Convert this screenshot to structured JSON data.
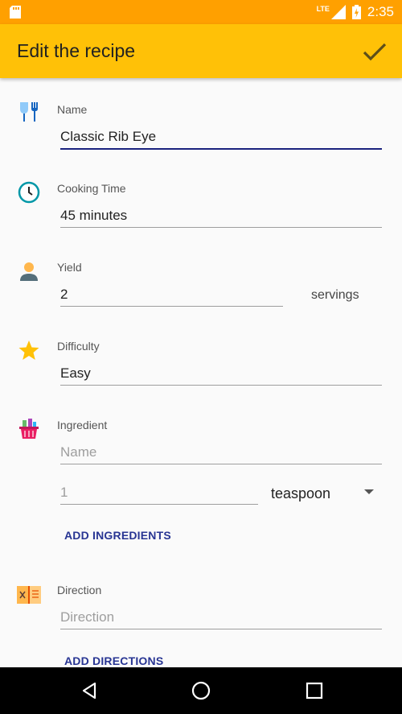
{
  "status_bar": {
    "network": "LTE",
    "time": "2:35"
  },
  "app_bar": {
    "title": "Edit the recipe",
    "confirm_icon": "check-icon"
  },
  "form": {
    "name": {
      "label": "Name",
      "value": "Classic Rib Eye",
      "icon": "fork-glass-icon"
    },
    "cooking_time": {
      "label": "Cooking Time",
      "value": "45 minutes",
      "icon": "clock-icon"
    },
    "yield": {
      "label": "Yield",
      "value": "2",
      "suffix": "servings",
      "icon": "person-icon"
    },
    "difficulty": {
      "label": "Difficulty",
      "value": "Easy",
      "icon": "star-icon"
    },
    "ingredient": {
      "label": "Ingredient",
      "name_placeholder": "Name",
      "quantity_placeholder": "1",
      "unit_selected": "teaspoon",
      "add_button": "ADD INGREDIENTS",
      "icon": "basket-icon"
    },
    "direction": {
      "label": "Direction",
      "placeholder": "Direction",
      "add_button": "ADD DIRECTIONS",
      "icon": "recipe-book-icon"
    }
  },
  "nav_bar": {
    "back_icon": "back-icon",
    "home_icon": "home-icon",
    "recents_icon": "recents-icon"
  },
  "colors": {
    "status_bar": "#ffa000",
    "app_bar": "#ffc107",
    "accent": "#1a237e",
    "button_text": "#283593"
  }
}
